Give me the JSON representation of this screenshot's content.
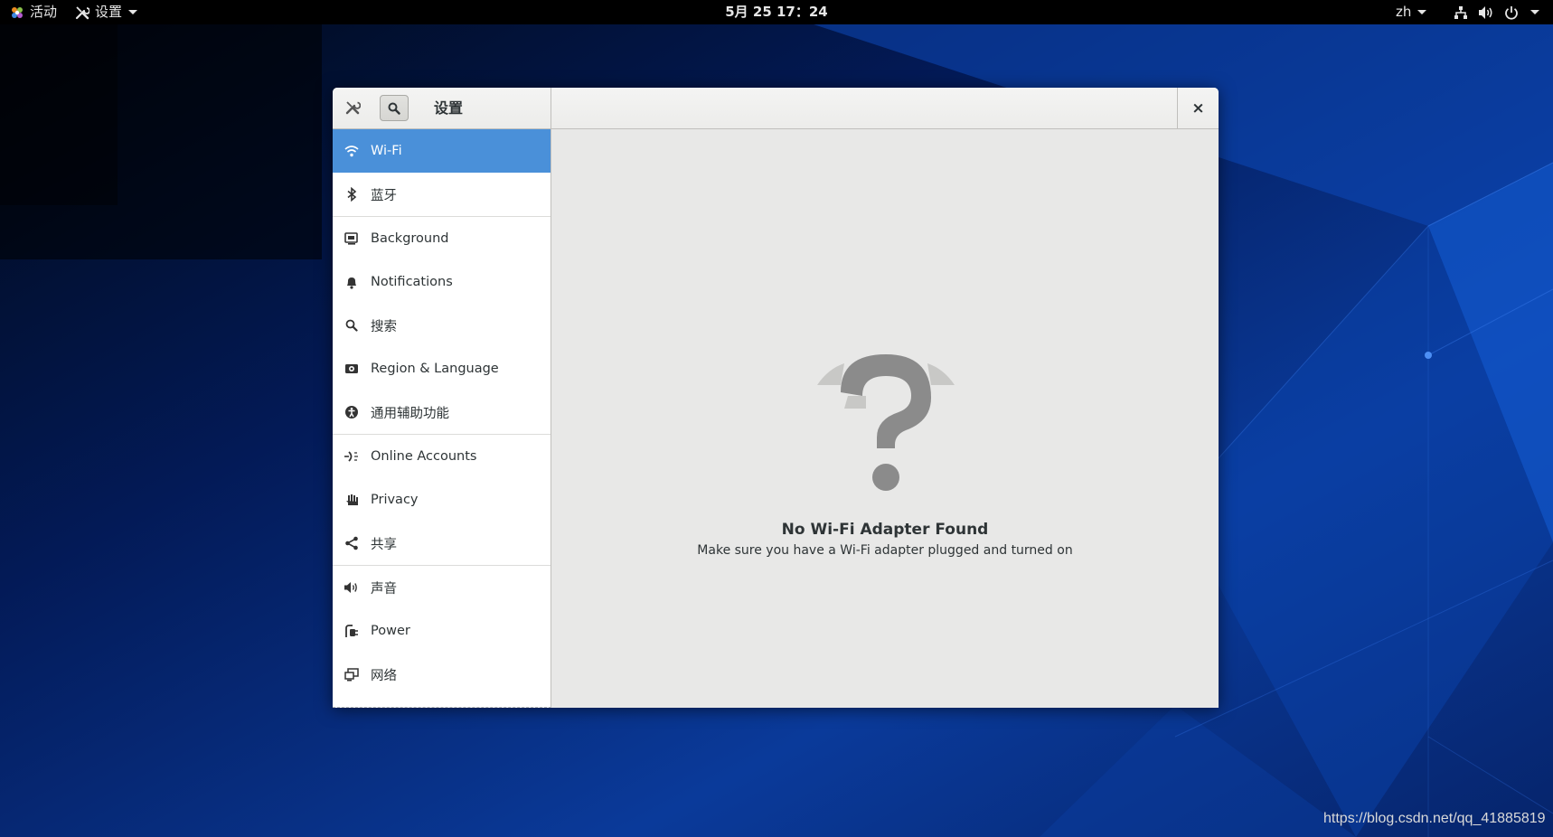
{
  "topbar": {
    "activities_label": "活动",
    "app_menu_label": "设置",
    "clock": "5月 25  17：24",
    "language": "zh"
  },
  "window": {
    "title": "设置",
    "close_label": "×"
  },
  "sidebar": {
    "items": [
      {
        "label": "Wi-Fi",
        "icon": "wifi-icon",
        "selected": true
      },
      {
        "label": "蓝牙",
        "icon": "bluetooth-icon"
      },
      {
        "label": "Background",
        "icon": "background-icon"
      },
      {
        "label": "Notifications",
        "icon": "bell-icon"
      },
      {
        "label": "搜索",
        "icon": "search-icon"
      },
      {
        "label": "Region & Language",
        "icon": "region-icon"
      },
      {
        "label": "通用辅助功能",
        "icon": "accessibility-icon"
      },
      {
        "label": "Online Accounts",
        "icon": "online-accounts-icon"
      },
      {
        "label": "Privacy",
        "icon": "privacy-hand-icon"
      },
      {
        "label": "共享",
        "icon": "share-icon"
      },
      {
        "label": "声音",
        "icon": "speaker-icon"
      },
      {
        "label": "Power",
        "icon": "power-plug-icon"
      },
      {
        "label": "网络",
        "icon": "network-icon"
      }
    ]
  },
  "content": {
    "empty_title": "No Wi-Fi Adapter Found",
    "empty_description": "Make sure you have a Wi-Fi adapter plugged and turned on"
  },
  "watermark": "https://blog.csdn.net/qq_41885819",
  "colors": {
    "selected_row": "#4a90d9",
    "content_bg": "#e8e8e7",
    "topbar_bg": "#000000"
  }
}
